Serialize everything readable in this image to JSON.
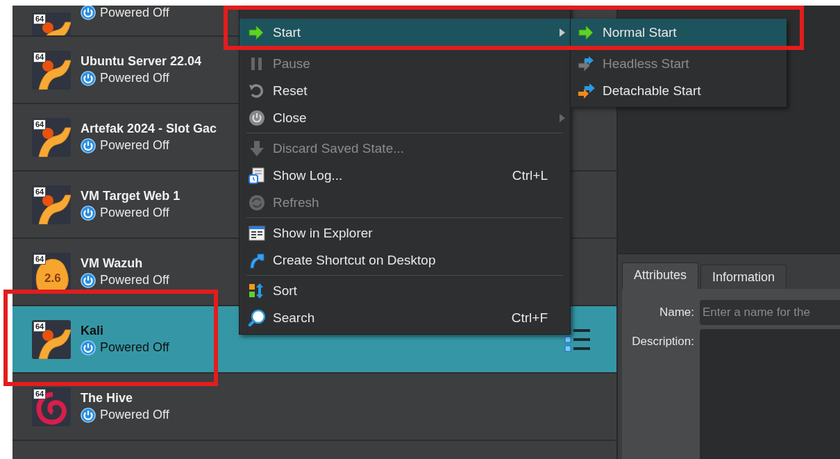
{
  "vm_list": [
    {
      "badge": "64",
      "status": "Powered Off",
      "selected": false
    },
    {
      "name": "Ubuntu Server 22.04",
      "badge": "64",
      "status": "Powered Off",
      "selected": false
    },
    {
      "name": "Artefak 2024 - Slot Gac",
      "badge": "64",
      "status": "Powered Off",
      "selected": false
    },
    {
      "name": "VM Target Web 1",
      "badge": "64",
      "status": "Powered Off",
      "selected": false
    },
    {
      "name": "VM Wazuh",
      "badge": "64",
      "version": "2.6",
      "status": "Powered Off",
      "selected": false
    },
    {
      "name": "Kali",
      "badge": "64",
      "status": "Powered Off",
      "selected": true
    },
    {
      "name": "The Hive",
      "badge": "64",
      "status": "Powered Off",
      "selected": false
    }
  ],
  "context_menu": {
    "items": [
      {
        "kind": "item",
        "label": "Start",
        "disabled": false,
        "selected": true,
        "submenu": true
      },
      {
        "kind": "item",
        "label": "Pause",
        "disabled": true,
        "selected": false,
        "submenu": false
      },
      {
        "kind": "item",
        "label": "Reset",
        "disabled": false,
        "selected": false,
        "submenu": false
      },
      {
        "kind": "item",
        "label": "Close",
        "disabled": false,
        "selected": false,
        "submenu": true
      },
      {
        "kind": "separator"
      },
      {
        "kind": "item",
        "label": "Discard Saved State...",
        "disabled": true,
        "selected": false,
        "submenu": false
      },
      {
        "kind": "item",
        "label": "Show Log...",
        "shortcut": "Ctrl+L",
        "disabled": false,
        "selected": false,
        "submenu": false
      },
      {
        "kind": "item",
        "label": "Refresh",
        "disabled": true,
        "selected": false,
        "submenu": false
      },
      {
        "kind": "separator"
      },
      {
        "kind": "item",
        "label": "Show in Explorer",
        "disabled": false,
        "selected": false,
        "submenu": false
      },
      {
        "kind": "item",
        "label": "Create Shortcut on Desktop",
        "disabled": false,
        "selected": false,
        "submenu": false
      },
      {
        "kind": "separator"
      },
      {
        "kind": "item",
        "label": "Sort",
        "disabled": false,
        "selected": false,
        "submenu": false
      },
      {
        "kind": "item",
        "label": "Search",
        "shortcut": "Ctrl+F",
        "disabled": false,
        "selected": false,
        "submenu": false
      }
    ]
  },
  "start_submenu": {
    "items": [
      {
        "label": "Normal Start",
        "disabled": false,
        "selected": true
      },
      {
        "label": "Headless Start",
        "disabled": true,
        "selected": false
      },
      {
        "label": "Detachable Start",
        "disabled": false,
        "selected": false
      }
    ]
  },
  "details": {
    "tabs": [
      {
        "label": "Attributes",
        "selected": true
      },
      {
        "label": "Information",
        "selected": false
      }
    ],
    "fields": [
      {
        "kind": "line",
        "label": "Name:",
        "placeholder": "Enter a name for the"
      },
      {
        "kind": "text",
        "label": "Description:"
      }
    ]
  }
}
